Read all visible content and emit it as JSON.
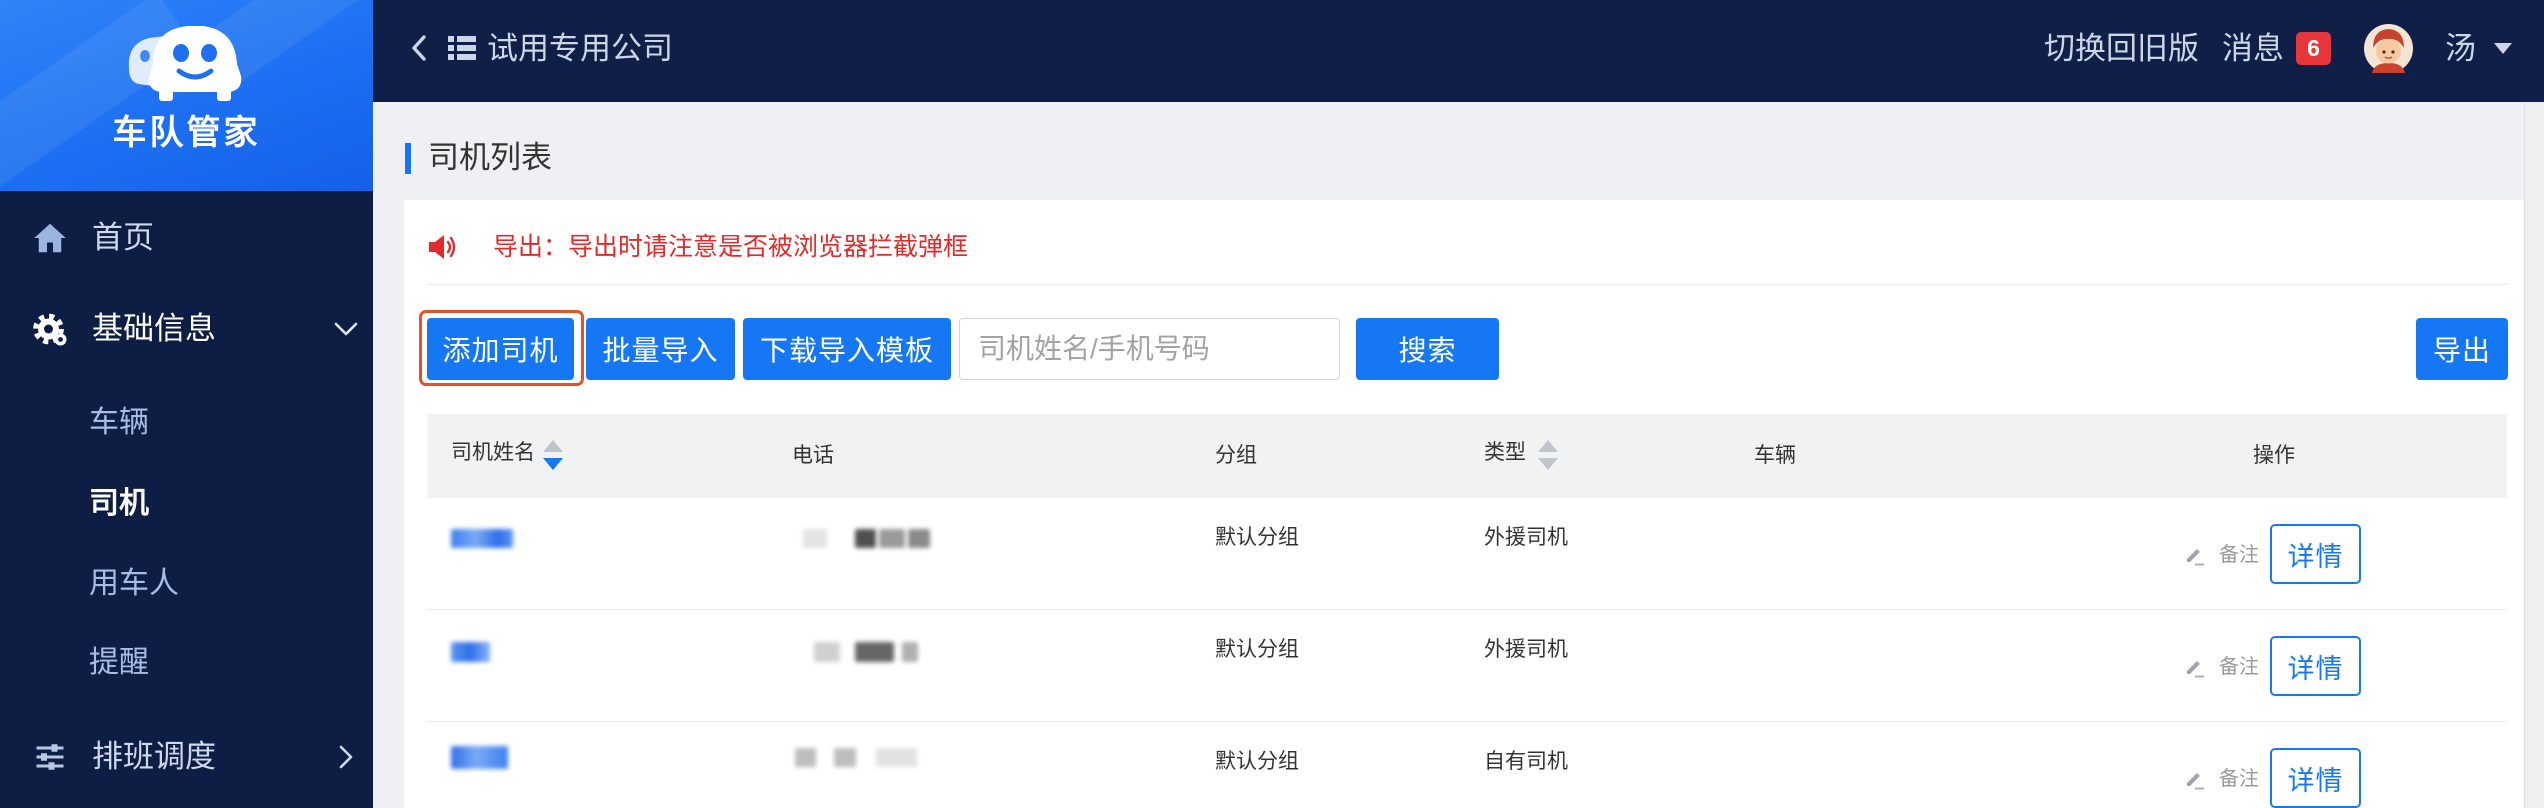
{
  "app": {
    "name": "车队管家"
  },
  "sidebar": {
    "items": [
      {
        "label": "首页",
        "icon": "home-icon"
      },
      {
        "label": "基础信息",
        "icon": "gear-icon",
        "expanded": true,
        "children": [
          {
            "label": "车辆"
          },
          {
            "label": "司机",
            "active": true
          },
          {
            "label": "用车人"
          },
          {
            "label": "提醒"
          }
        ]
      },
      {
        "label": "排班调度",
        "icon": "sliders-icon",
        "expanded": false
      }
    ]
  },
  "topbar": {
    "company": "试用专用公司",
    "switch_old_version": "切换回旧版",
    "messages_label": "消息",
    "messages_badge": "6",
    "user_name": "汤"
  },
  "page": {
    "title": "司机列表"
  },
  "notice": {
    "icon": "speaker-icon",
    "text": "导出：导出时请注意是否被浏览器拦截弹框"
  },
  "toolbar": {
    "add_driver": "添加司机",
    "batch_import": "批量导入",
    "download_template": "下载导入模板",
    "search_placeholder": "司机姓名/手机号码",
    "search": "搜索",
    "export": "导出"
  },
  "table": {
    "columns": [
      {
        "label": "司机姓名",
        "sortable": true,
        "sort_desc_active": true
      },
      {
        "label": "电话"
      },
      {
        "label": "分组"
      },
      {
        "label": "类型",
        "sortable": true,
        "sort_desc_active": false
      },
      {
        "label": "车辆"
      },
      {
        "label": "操作"
      }
    ],
    "rows": [
      {
        "group": "默认分组",
        "type": "外援司机",
        "remark": "备注",
        "detail": "详情"
      },
      {
        "group": "默认分组",
        "type": "外援司机",
        "remark": "备注",
        "detail": "详情"
      },
      {
        "group": "默认分组",
        "type": "自有司机",
        "remark": "备注",
        "detail": "详情"
      }
    ]
  },
  "colors": {
    "primary": "#1677f5",
    "sidebar_bg": "#0e1d43",
    "topbar_bg": "#0f1f47",
    "logo_bg": "#1d6ff2",
    "notice_red": "#e32a2a",
    "badge_red": "#e8373a",
    "highlight_outline": "#e4522a",
    "page_bg": "#eef0f3"
  }
}
